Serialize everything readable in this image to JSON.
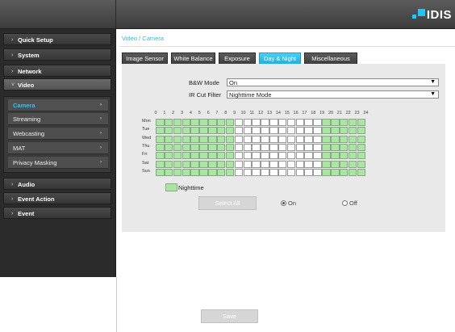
{
  "brand": {
    "logo_text": "IDIS",
    "accent": "#1ec5ff"
  },
  "sidebar": {
    "items": [
      {
        "label": "Quick Setup",
        "chevron": "›"
      },
      {
        "label": "System",
        "chevron": "›"
      },
      {
        "label": "Network",
        "chevron": "›"
      },
      {
        "label": "Video",
        "chevron": "˅"
      },
      {
        "label": "Audio",
        "chevron": "›"
      },
      {
        "label": "Event Action",
        "chevron": "›"
      },
      {
        "label": "Event",
        "chevron": "›"
      }
    ],
    "video_sub": [
      {
        "label": "Camera",
        "arrow": "›"
      },
      {
        "label": "Streaming",
        "arrow": "›"
      },
      {
        "label": "Webcasting",
        "arrow": "›"
      },
      {
        "label": "MAT",
        "arrow": "›"
      },
      {
        "label": "Privacy Masking",
        "arrow": "›"
      }
    ]
  },
  "breadcrumb": "Video / Camera",
  "tabs": [
    {
      "label": "Image Sensor"
    },
    {
      "label": "White Balance"
    },
    {
      "label": "Exposure"
    },
    {
      "label": "Day & Night"
    },
    {
      "label": "Miscellaneous"
    }
  ],
  "bw_mode": {
    "label": "B&W Mode",
    "value": "On",
    "arrow": "▼"
  },
  "ir_cut": {
    "label": "IR Cut Filter",
    "value": "Nighttime Mode",
    "arrow": "▼"
  },
  "schedule": {
    "hours": [
      "0",
      "1",
      "2",
      "3",
      "4",
      "5",
      "6",
      "7",
      "8",
      "9",
      "10",
      "11",
      "12",
      "13",
      "14",
      "15",
      "16",
      "17",
      "18",
      "19",
      "20",
      "21",
      "22",
      "23",
      "24"
    ],
    "days": [
      "Mon",
      "Tue",
      "Wed",
      "Thu",
      "Fri",
      "Sat",
      "Sun"
    ],
    "nighttime_hours": [
      0,
      1,
      2,
      3,
      4,
      5,
      6,
      7,
      8,
      19,
      20,
      21,
      22,
      23
    ],
    "nighttime_color": "#a9e6a1"
  },
  "legend": {
    "label": "Nighttime"
  },
  "select_all": "Select All",
  "radio_on": "On",
  "radio_off": "Off",
  "save": "Save"
}
